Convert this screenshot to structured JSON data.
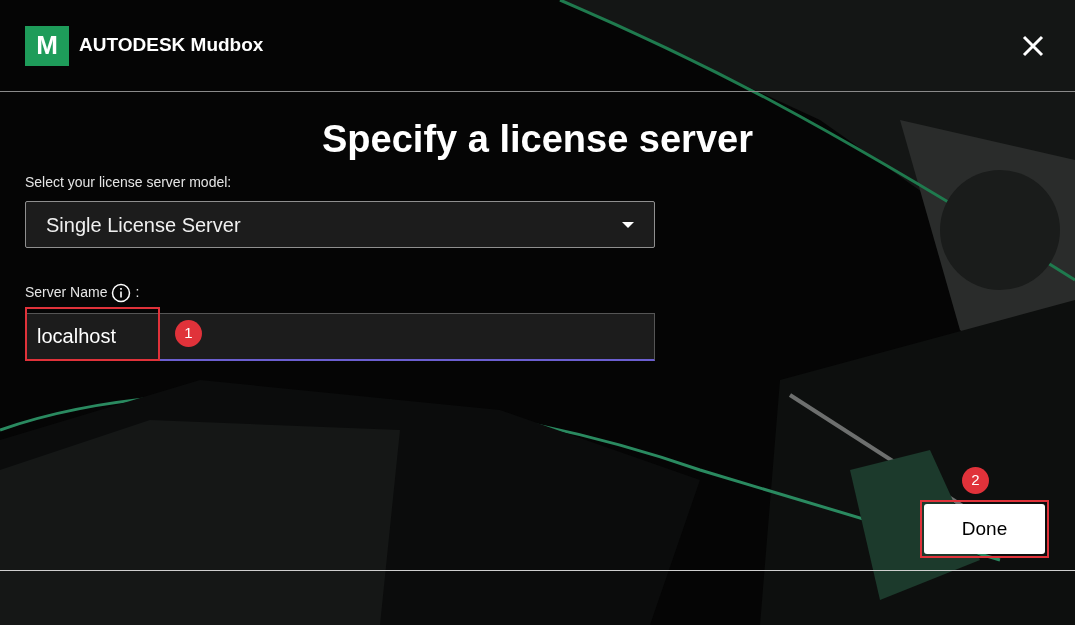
{
  "header": {
    "logo_letter": "M",
    "brand": "AUTODESK",
    "product": "Mudbox"
  },
  "title": "Specify a license server",
  "model_field": {
    "label": "Select your license server model:",
    "value": "Single License Server"
  },
  "server_field": {
    "label": "Server Name",
    "suffix": ":",
    "value": "localhost"
  },
  "annotations": [
    {
      "number": "1"
    },
    {
      "number": "2"
    }
  ],
  "done_button": "Done"
}
